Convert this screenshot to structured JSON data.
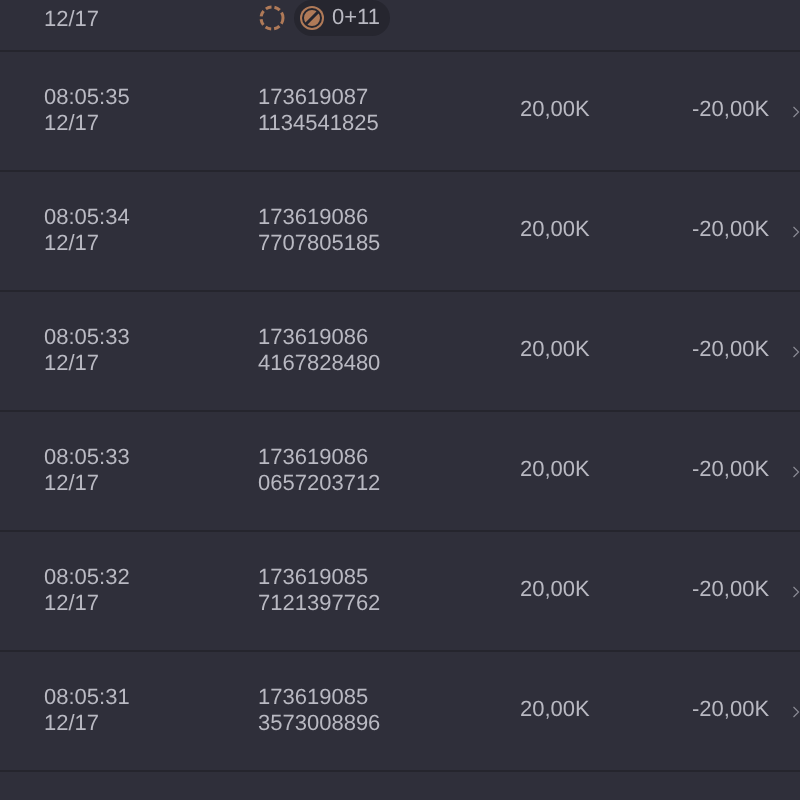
{
  "partial_top": {
    "date": "12/17",
    "badge": "0+11"
  },
  "rows": [
    {
      "time": "08:05:35",
      "date": "12/17",
      "id_1": "173619087",
      "id_2": "1134541825",
      "amount": "20,00K",
      "net": "-20,00K"
    },
    {
      "time": "08:05:34",
      "date": "12/17",
      "id_1": "173619086",
      "id_2": "7707805185",
      "amount": "20,00K",
      "net": "-20,00K"
    },
    {
      "time": "08:05:33",
      "date": "12/17",
      "id_1": "173619086",
      "id_2": "4167828480",
      "amount": "20,00K",
      "net": "-20,00K"
    },
    {
      "time": "08:05:33",
      "date": "12/17",
      "id_1": "173619086",
      "id_2": "0657203712",
      "amount": "20,00K",
      "net": "-20,00K"
    },
    {
      "time": "08:05:32",
      "date": "12/17",
      "id_1": "173619085",
      "id_2": "7121397762",
      "amount": "20,00K",
      "net": "-20,00K"
    },
    {
      "time": "08:05:31",
      "date": "12/17",
      "id_1": "173619085",
      "id_2": "3573008896",
      "amount": "20,00K",
      "net": "-20,00K"
    }
  ]
}
